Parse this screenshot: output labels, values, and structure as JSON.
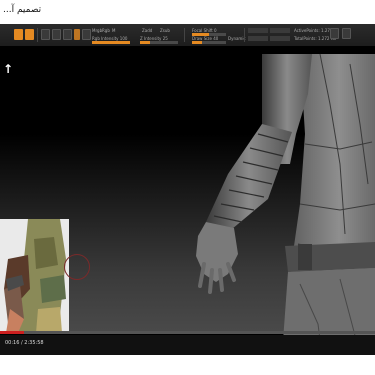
{
  "page": {
    "title": "تصميم آ..."
  },
  "player": {
    "current_time": "00:16",
    "duration": "2:35:58",
    "time_separator": " / ",
    "progress_fraction": 0.065
  },
  "toolbar": {
    "labels": {
      "mrgb": "Mrgb",
      "rgb": "Rgb",
      "m": "M",
      "zadd": "Zadd",
      "zsub": "Zsub",
      "focal_shift": "Focal Shift 0",
      "draw_size": "Draw Size 40",
      "dynamic": "Dynamic",
      "rgb_intensity": "Rgb Intensity 100",
      "z_intensity": "Z Intensity 25",
      "active_points": "ActivePoints: 1.272 Mil",
      "total_points": "TotalPoints: 1.272 Mil"
    },
    "rgb_intensity_fraction": 1.0,
    "z_intensity_fraction": 0.25,
    "focal_fraction": 0.5,
    "draw_size_fraction": 0.3
  },
  "colors": {
    "accent": "#e58a22",
    "progress": "#cc1f1f"
  }
}
